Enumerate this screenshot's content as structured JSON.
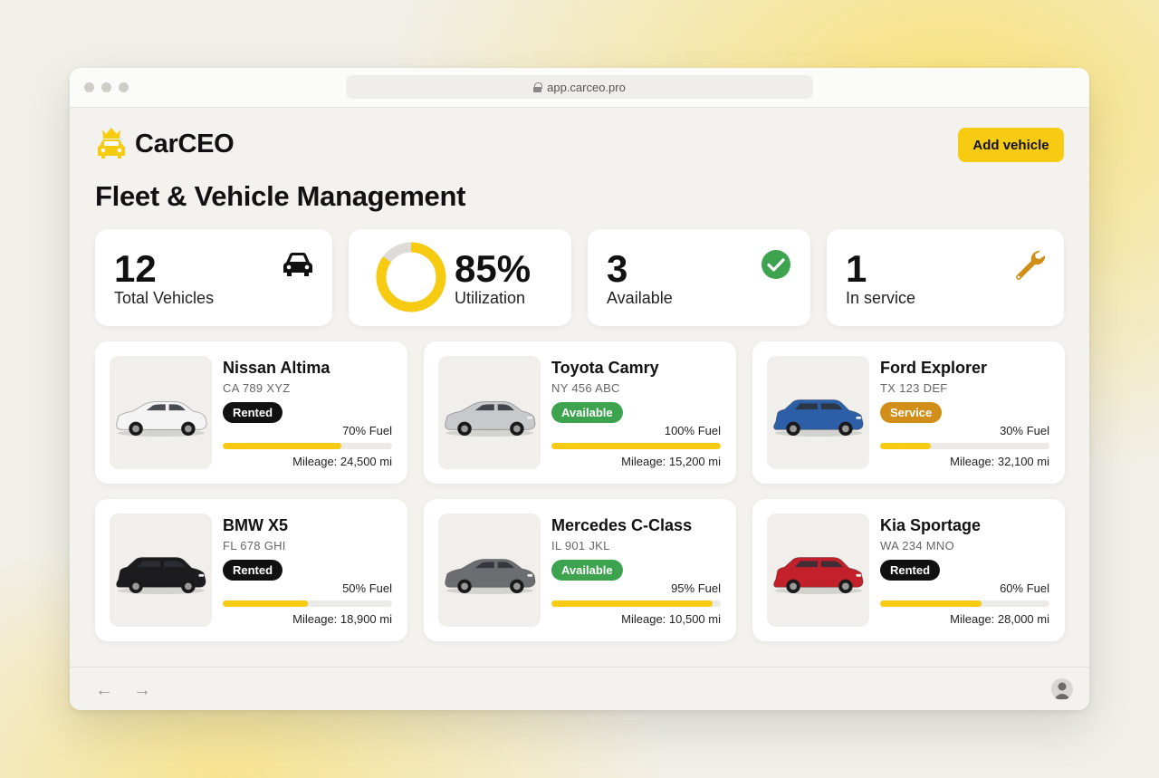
{
  "browser": {
    "url": "app.carceo.pro"
  },
  "brand": {
    "name": "CarCEO"
  },
  "header": {
    "add_button": "Add vehicle"
  },
  "page_title": "Fleet & Vehicle Management",
  "stats": [
    {
      "value": "12",
      "label": "Total Vehicles",
      "icon": "car-icon"
    },
    {
      "value": "85%",
      "label": "Utilization",
      "icon": "donut-chart",
      "fraction": 0.85
    },
    {
      "value": "3",
      "label": "Available",
      "icon": "check-circle-icon"
    },
    {
      "value": "1",
      "label": "In service",
      "icon": "wrench-icon"
    }
  ],
  "vehicles": [
    {
      "name": "Nissan Altima",
      "plate": "CA 789 XYZ",
      "status": "Rented",
      "fuel": "70% Fuel",
      "fuel_level": 0.7,
      "mileage": "Mileage: 24,500 mi",
      "color": "#f4f4f4",
      "body": "sedan"
    },
    {
      "name": "Toyota Camry",
      "plate": "NY 456 ABC",
      "status": "Available",
      "fuel": "100% Fuel",
      "fuel_level": 1.0,
      "mileage": "Mileage: 15,200 mi",
      "color": "#c8c9cb",
      "body": "sedan"
    },
    {
      "name": "Ford Explorer",
      "plate": "TX 123 DEF",
      "status": "Service",
      "fuel": "30% Fuel",
      "fuel_level": 0.3,
      "mileage": "Mileage: 32,100 mi",
      "color": "#2d5fa8",
      "body": "suv"
    },
    {
      "name": "BMW X5",
      "plate": "FL 678 GHI",
      "status": "Rented",
      "fuel": "50% Fuel",
      "fuel_level": 0.5,
      "mileage": "Mileage: 18,900 mi",
      "color": "#1c1c1e",
      "body": "suv"
    },
    {
      "name": "Mercedes C-Class",
      "plate": "IL 901 JKL",
      "status": "Available",
      "fuel": "95% Fuel",
      "fuel_level": 0.95,
      "mileage": "Mileage: 10,500 mi",
      "color": "#6b6d70",
      "body": "sedan"
    },
    {
      "name": "Kia Sportage",
      "plate": "WA 234 MNO",
      "status": "Rented",
      "fuel": "60% Fuel",
      "fuel_level": 0.6,
      "mileage": "Mileage: 28,000 mi",
      "color": "#c2212b",
      "body": "suv"
    }
  ],
  "status_colors": {
    "Rented": "#111111",
    "Available": "#3ea34f",
    "Service": "#d18f1a"
  },
  "accent": "#f6cb12"
}
